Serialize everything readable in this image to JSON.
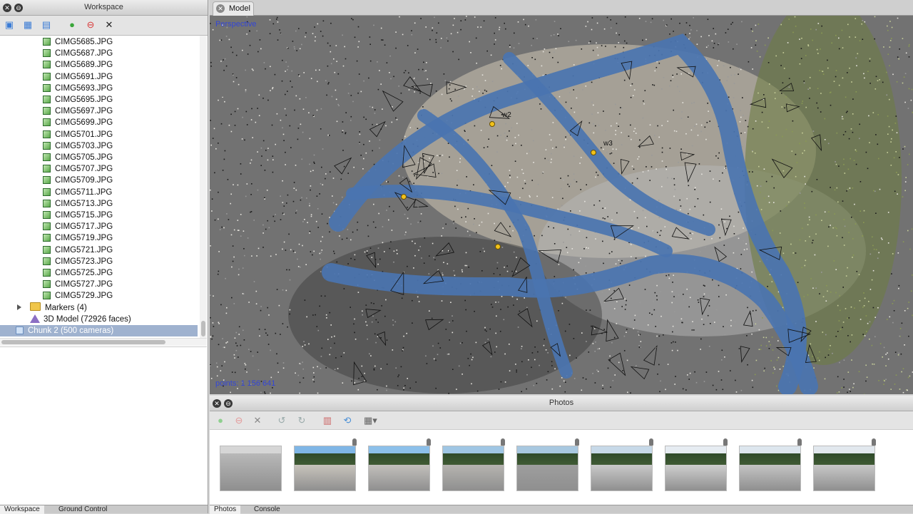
{
  "workspace": {
    "title": "Workspace",
    "toolbar": [
      "add-chunk-icon",
      "add-photos-icon",
      "add-folder-icon",
      "enable-icon",
      "disable-icon",
      "remove-icon"
    ],
    "images": [
      "CIMG5685.JPG",
      "CIMG5687.JPG",
      "CIMG5689.JPG",
      "CIMG5691.JPG",
      "CIMG5693.JPG",
      "CIMG5695.JPG",
      "CIMG5697.JPG",
      "CIMG5699.JPG",
      "CIMG5701.JPG",
      "CIMG5703.JPG",
      "CIMG5705.JPG",
      "CIMG5707.JPG",
      "CIMG5709.JPG",
      "CIMG5711.JPG",
      "CIMG5713.JPG",
      "CIMG5715.JPG",
      "CIMG5717.JPG",
      "CIMG5719.JPG",
      "CIMG5721.JPG",
      "CIMG5723.JPG",
      "CIMG5725.JPG",
      "CIMG5727.JPG",
      "CIMG5729.JPG"
    ],
    "markers_label": "Markers (4)",
    "model_label": "3D Model (72926 faces)",
    "chunk_label": "Chunk 2 (500 cameras)",
    "bottom_tabs": [
      "Workspace",
      "Ground Control"
    ]
  },
  "model": {
    "tab_label": "Model",
    "projection": "Perspective",
    "points_label": "points: 1 156 641",
    "markers": [
      "w2",
      "w3"
    ]
  },
  "photos": {
    "title": "Photos",
    "bottom_tabs": [
      "Photos",
      "Console"
    ],
    "thumbnails": [
      {
        "sky": "#d6d6d6",
        "trees": false,
        "ground": "#b8b8b8"
      },
      {
        "sky": "#7fb6e6",
        "trees": true,
        "ground": "#c8c4bc"
      },
      {
        "sky": "#8cc0ea",
        "trees": true,
        "ground": "#c2c0bc"
      },
      {
        "sky": "#9fc6e4",
        "trees": true,
        "ground": "#b6b4b0"
      },
      {
        "sky": "#a8c8e0",
        "trees": true,
        "ground": "#9e9e9e"
      },
      {
        "sky": "#c7d9e8",
        "trees": true,
        "ground": "#c9c9c9"
      },
      {
        "sky": "#e6ecf2",
        "trees": true,
        "ground": "#cfcfcf"
      },
      {
        "sky": "#dde6ee",
        "trees": true,
        "ground": "#c4c4c4"
      },
      {
        "sky": "#e2e8ee",
        "trees": true,
        "ground": "#c8c8c8"
      }
    ]
  }
}
